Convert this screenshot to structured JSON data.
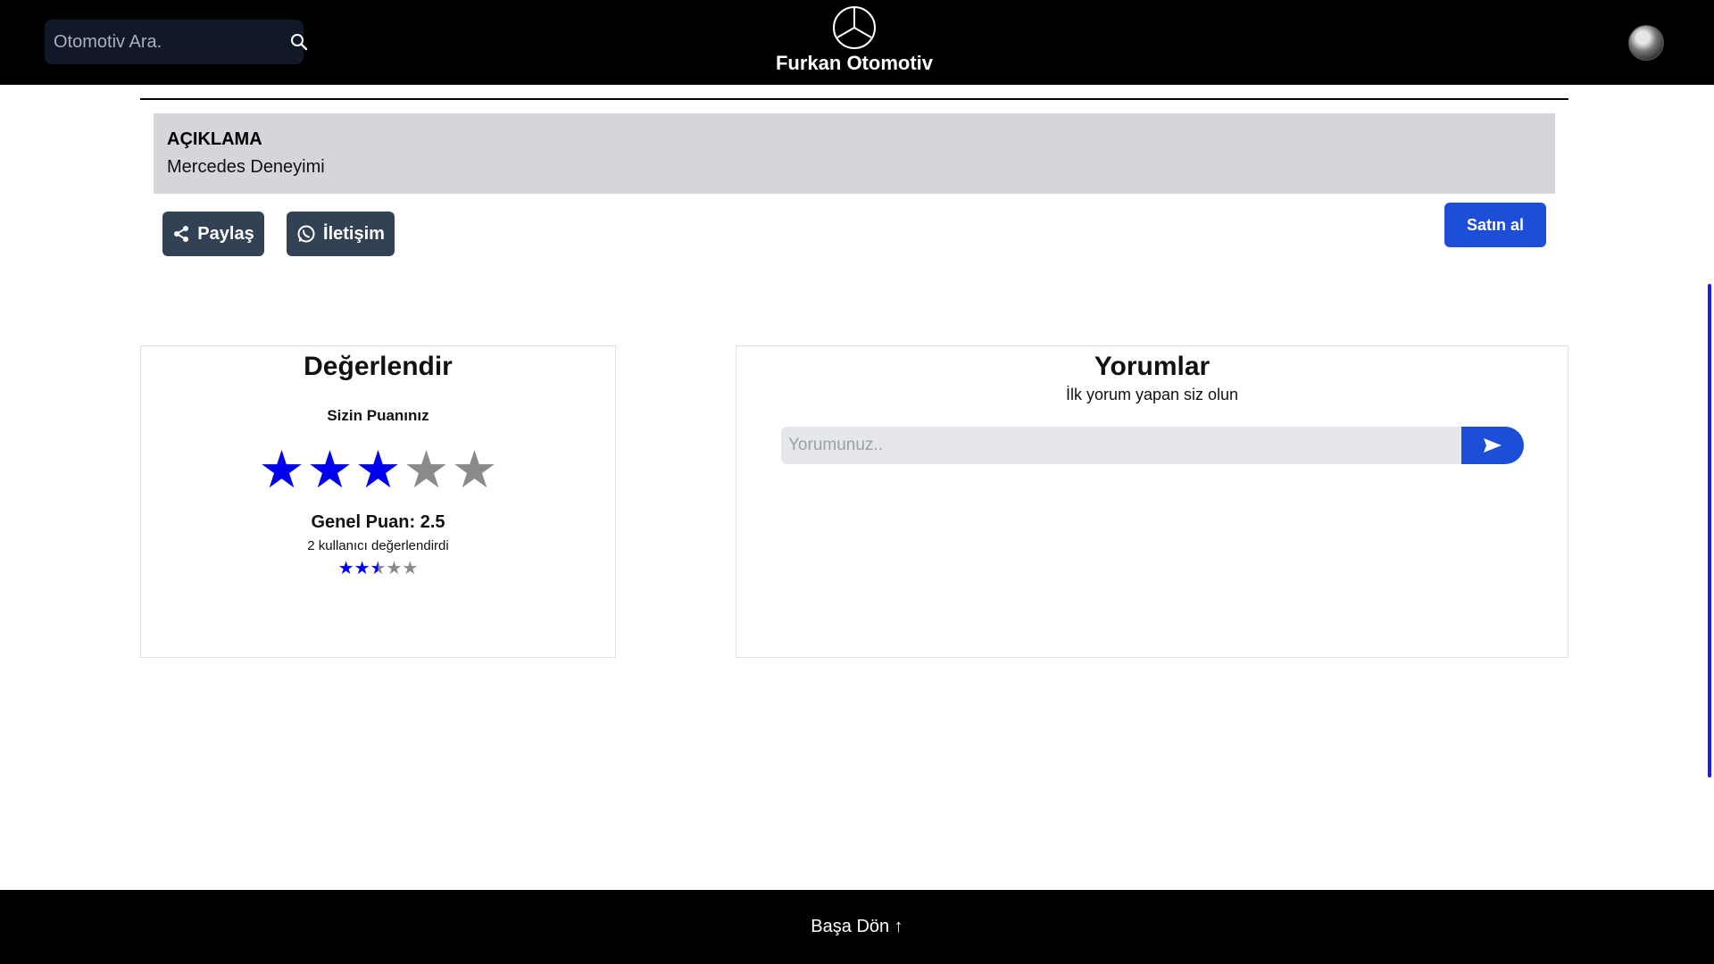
{
  "header": {
    "search_placeholder": "Otomotiv Ara.",
    "brand": "Furkan Otomotiv",
    "icons": {
      "search": "search-icon",
      "logo": "mercedes-star-logo",
      "avatar": "user-avatar"
    }
  },
  "description": {
    "title": "AÇIKLAMA",
    "text": "Mercedes Deneyimi"
  },
  "actions": {
    "share_label": "Paylaş",
    "contact_label": "İletişim",
    "buy_label": "Satın al",
    "icons": {
      "share": "share-icon",
      "contact": "whatsapp-icon"
    }
  },
  "rating": {
    "title": "Değerlendir",
    "your_rating_label": "Sizin Puanınız",
    "user_rating": 3,
    "max_rating": 5,
    "overall_label": "Genel Puan: 2.5",
    "overall_value": 2.5,
    "voters_text": "2 kullanıcı değerlendirdi",
    "star_glyph": "★"
  },
  "comments": {
    "title": "Yorumlar",
    "empty_text": "İlk yorum yapan siz olun",
    "input_placeholder": "Yorumunuz..",
    "send_icon": "send-icon"
  },
  "footer": {
    "back_to_top": "Başa Dön ↑"
  },
  "colors": {
    "header_bg": "#000000",
    "accent": "#1d4ed8",
    "dark_button": "#334155",
    "star_active": "#0000ee",
    "star_inactive": "#8a8a8a",
    "description_bg": "#d6d6da"
  }
}
